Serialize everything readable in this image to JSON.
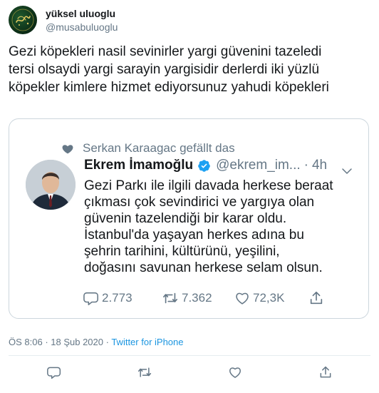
{
  "tweet": {
    "display_name": "yüksel uluoglu",
    "handle": "@musabuluoglu",
    "text": "Gezi köpekleri nasil sevinirler yargi güvenini tazeledi\ntersi olsaydi yargi sarayin yargisidir derlerdi iki yüzlü\nköpekler kimlere hizmet ediyorsunuz yahudi köpekleri",
    "time": "ÖS 8:06",
    "separator": " · ",
    "date": "18 Şub 2020",
    "source": "Twitter for iPhone"
  },
  "quoted": {
    "social_context": "Serkan Karaagac gefällt das",
    "name": "Ekrem İmamoğlu",
    "handle": "@ekrem_im...",
    "dot": "·",
    "time": "4h",
    "text": "Gezi Parkı ile ilgili davada herkese beraat\nçıkması çok sevindirici ve yargıya olan\ngüvenin tazelendiği bir karar oldu.\nİstanbul'da yaşayan herkes adına bu\nşehrin tarihini, kültürünü, yeşilini,\ndoğasını savunan herkese selam olsun.",
    "replies": "2.773",
    "retweets": "7.362",
    "likes": "72,3K"
  },
  "icons": {
    "verified": "verified-badge-icon",
    "heart": "heart-icon",
    "reply": "reply-icon",
    "retweet": "retweet-icon",
    "share": "share-icon",
    "more": "chevron-down-icon"
  },
  "colors": {
    "text": "#14171a",
    "secondary": "#657786",
    "link": "#1b95e0",
    "border": "#ccd6dd"
  }
}
